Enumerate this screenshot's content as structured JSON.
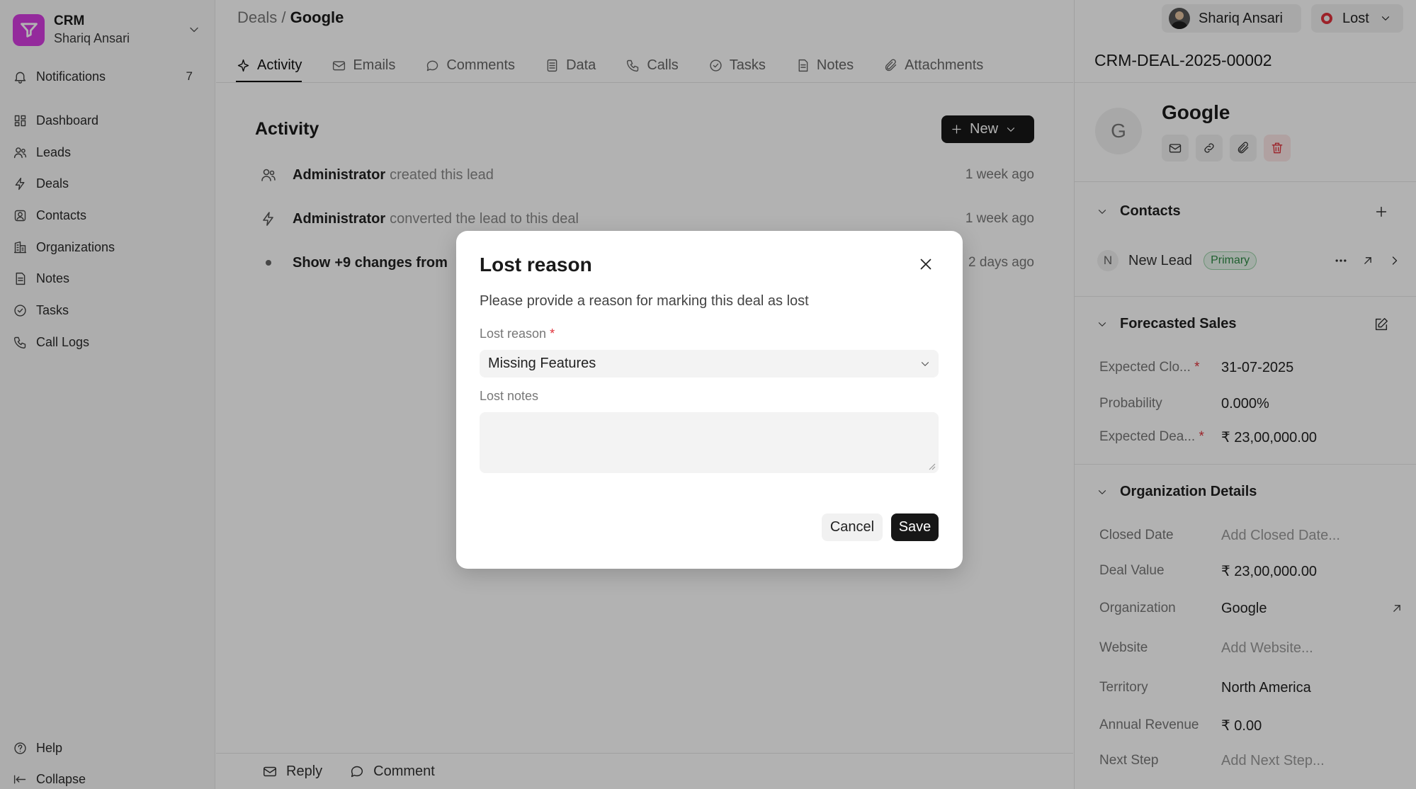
{
  "brand": {
    "title": "CRM",
    "subtitle": "Shariq Ansari",
    "icon": "funnel-logo-icon",
    "color": "#d43de0"
  },
  "sidebar": {
    "notifications": {
      "label": "Notifications",
      "count": "7"
    },
    "items": [
      {
        "label": "Dashboard",
        "icon": "dashboard-icon"
      },
      {
        "label": "Leads",
        "icon": "users-icon"
      },
      {
        "label": "Deals",
        "icon": "lightning-icon"
      },
      {
        "label": "Contacts",
        "icon": "contact-icon"
      },
      {
        "label": "Organizations",
        "icon": "building-icon"
      },
      {
        "label": "Notes",
        "icon": "note-icon"
      },
      {
        "label": "Tasks",
        "icon": "check-circle-icon"
      },
      {
        "label": "Call Logs",
        "icon": "phone-icon"
      }
    ],
    "help": "Help",
    "collapse": "Collapse"
  },
  "header": {
    "crumb_parent": "Deals",
    "crumb_sep": "/",
    "crumb_current": "Google"
  },
  "tabs": [
    {
      "label": "Activity",
      "icon": "activity-icon",
      "active": true
    },
    {
      "label": "Emails",
      "icon": "mail-icon"
    },
    {
      "label": "Comments",
      "icon": "comment-icon"
    },
    {
      "label": "Data",
      "icon": "data-icon"
    },
    {
      "label": "Calls",
      "icon": "phone-icon"
    },
    {
      "label": "Tasks",
      "icon": "check-circle-icon"
    },
    {
      "label": "Notes",
      "icon": "note-icon"
    },
    {
      "label": "Attachments",
      "icon": "paperclip-icon"
    }
  ],
  "activity": {
    "title": "Activity",
    "new_label": "New",
    "rows": [
      {
        "who": "Administrator",
        "what": "created this lead",
        "when": "1 week ago"
      },
      {
        "who": "Administrator",
        "what": "converted the lead to this deal",
        "when": "1 week ago"
      },
      {
        "who": "Show",
        "what": "+9 changes from",
        "when": "2 days ago"
      }
    ]
  },
  "bottom": {
    "reply": "Reply",
    "comment": "Comment"
  },
  "topright": {
    "user": "Shariq Ansari",
    "status": "Lost",
    "status_color": "#e0323b"
  },
  "deal": {
    "id": "CRM-DEAL-2025-00002",
    "org_initial": "G",
    "org_name": "Google"
  },
  "contacts": {
    "title": "Contacts",
    "items": [
      {
        "initial": "N",
        "name": "New Lead",
        "badge": "Primary"
      }
    ]
  },
  "forecast": {
    "title": "Forecasted Sales",
    "fields": [
      {
        "label": "Expected Clo...",
        "required": "*",
        "value": "31-07-2025"
      },
      {
        "label": "Probability",
        "required": "",
        "value": "0.000%"
      },
      {
        "label": "Expected Dea...",
        "required": "*",
        "value": "₹ 23,00,000.00"
      }
    ]
  },
  "org_details": {
    "title": "Organization Details",
    "fields": [
      {
        "label": "Closed Date",
        "value": "Add Closed Date..."
      },
      {
        "label": "Deal Value",
        "value": "₹ 23,00,000.00"
      },
      {
        "label": "Organization",
        "value": "Google"
      },
      {
        "label": "Website",
        "value": "Add Website..."
      },
      {
        "label": "Territory",
        "value": "North America"
      },
      {
        "label": "Annual Revenue",
        "value": "₹ 0.00"
      },
      {
        "label": "Next Step",
        "value": "Add Next Step..."
      }
    ]
  },
  "modal": {
    "title": "Lost reason",
    "description": "Please provide a reason for marking this deal as lost",
    "reason_label": "Lost reason",
    "required": "*",
    "reason_value": "Missing Features",
    "notes_label": "Lost notes",
    "notes_value": "",
    "cancel": "Cancel",
    "save": "Save"
  }
}
